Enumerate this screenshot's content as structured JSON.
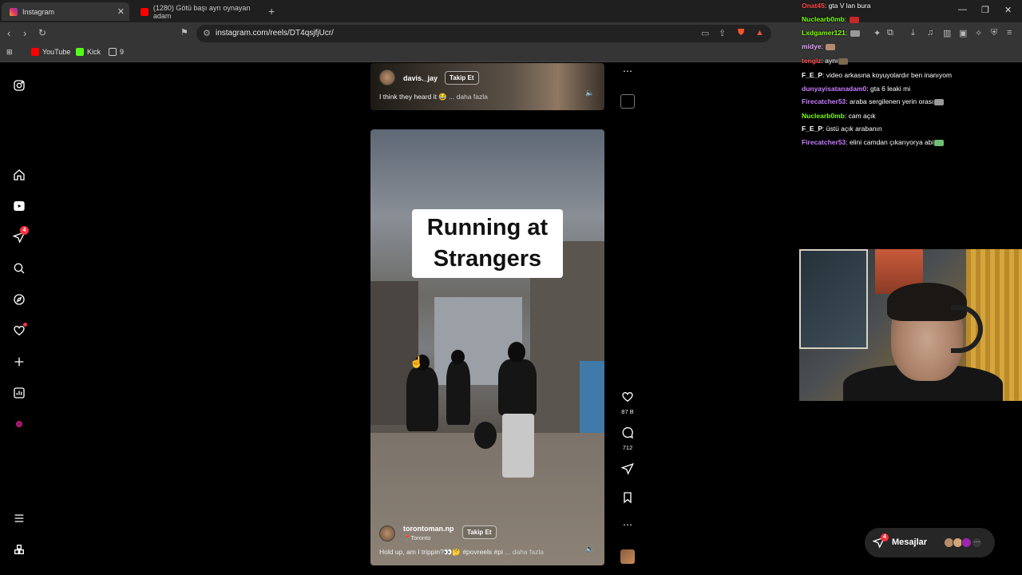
{
  "browser": {
    "tabs": [
      {
        "label": "Instagram",
        "active": true
      },
      {
        "label": "(1280) Götü başı ayrı oynayan adam",
        "active": false
      }
    ],
    "url": "instagram.com/reels/DT4qsjfjUcr/",
    "bookmarks": [
      {
        "label": "YouTube",
        "color": "#ff0000"
      },
      {
        "label": "Kick",
        "color": "#53fc18"
      },
      {
        "label": "9",
        "color": "#cccccc"
      }
    ]
  },
  "sidebar": {
    "notifications_badge": "4"
  },
  "reels": {
    "top": {
      "username": "davis._jay",
      "follow_label": "Takip Et",
      "caption": "I think they heard it 😂",
      "more_label": "... daha fazla"
    },
    "main": {
      "overlay_title_line1": "Running at",
      "overlay_title_line2": "Strangers",
      "username": "torontoman.np",
      "location": "Toronto",
      "follow_label": "Takip Et",
      "caption": "Hold up, am I trippin?👀🤔 #povreels #pi",
      "more_label": "... daha fazla"
    }
  },
  "actions": {
    "likes": "87 B",
    "comments": "712"
  },
  "chat": [
    {
      "user": "Onat45",
      "text": "gta V lan bura",
      "color": "#ff4b4b"
    },
    {
      "user": "Nuclearb0mb",
      "text": "",
      "color": "#7cfc00"
    },
    {
      "user": "Lxdgamer121",
      "text": "",
      "color": "#7cfc00"
    },
    {
      "user": "midye",
      "text": "",
      "color": "#e6a5ff"
    },
    {
      "user": "tengiz",
      "text": "aynı",
      "color": "#ff4b4b"
    },
    {
      "user": "F_E_P",
      "text": "video arkasına koyuyolardır ben inanıyom",
      "color": "#ffffff"
    },
    {
      "user": "dunyayisatanadam0",
      "text": "gta 6 leaki mi",
      "color": "#c77dff"
    },
    {
      "user": "Firecatcher53",
      "text": "araba sergilenen yerin orası",
      "color": "#c77dff"
    },
    {
      "user": "Nuclearb0mb",
      "text": "cam açık",
      "color": "#7cfc00"
    },
    {
      "user": "F_E_P",
      "text": "üstü açık arabanın",
      "color": "#ffffff"
    },
    {
      "user": "Firecatcher53",
      "text": "elini camdan çıkarıyorya abi",
      "color": "#c77dff"
    }
  ],
  "messages": {
    "label": "Mesajlar",
    "badge": "4"
  },
  "colors": {
    "accent_red": "#ff3040",
    "page_bg": "#000000"
  }
}
